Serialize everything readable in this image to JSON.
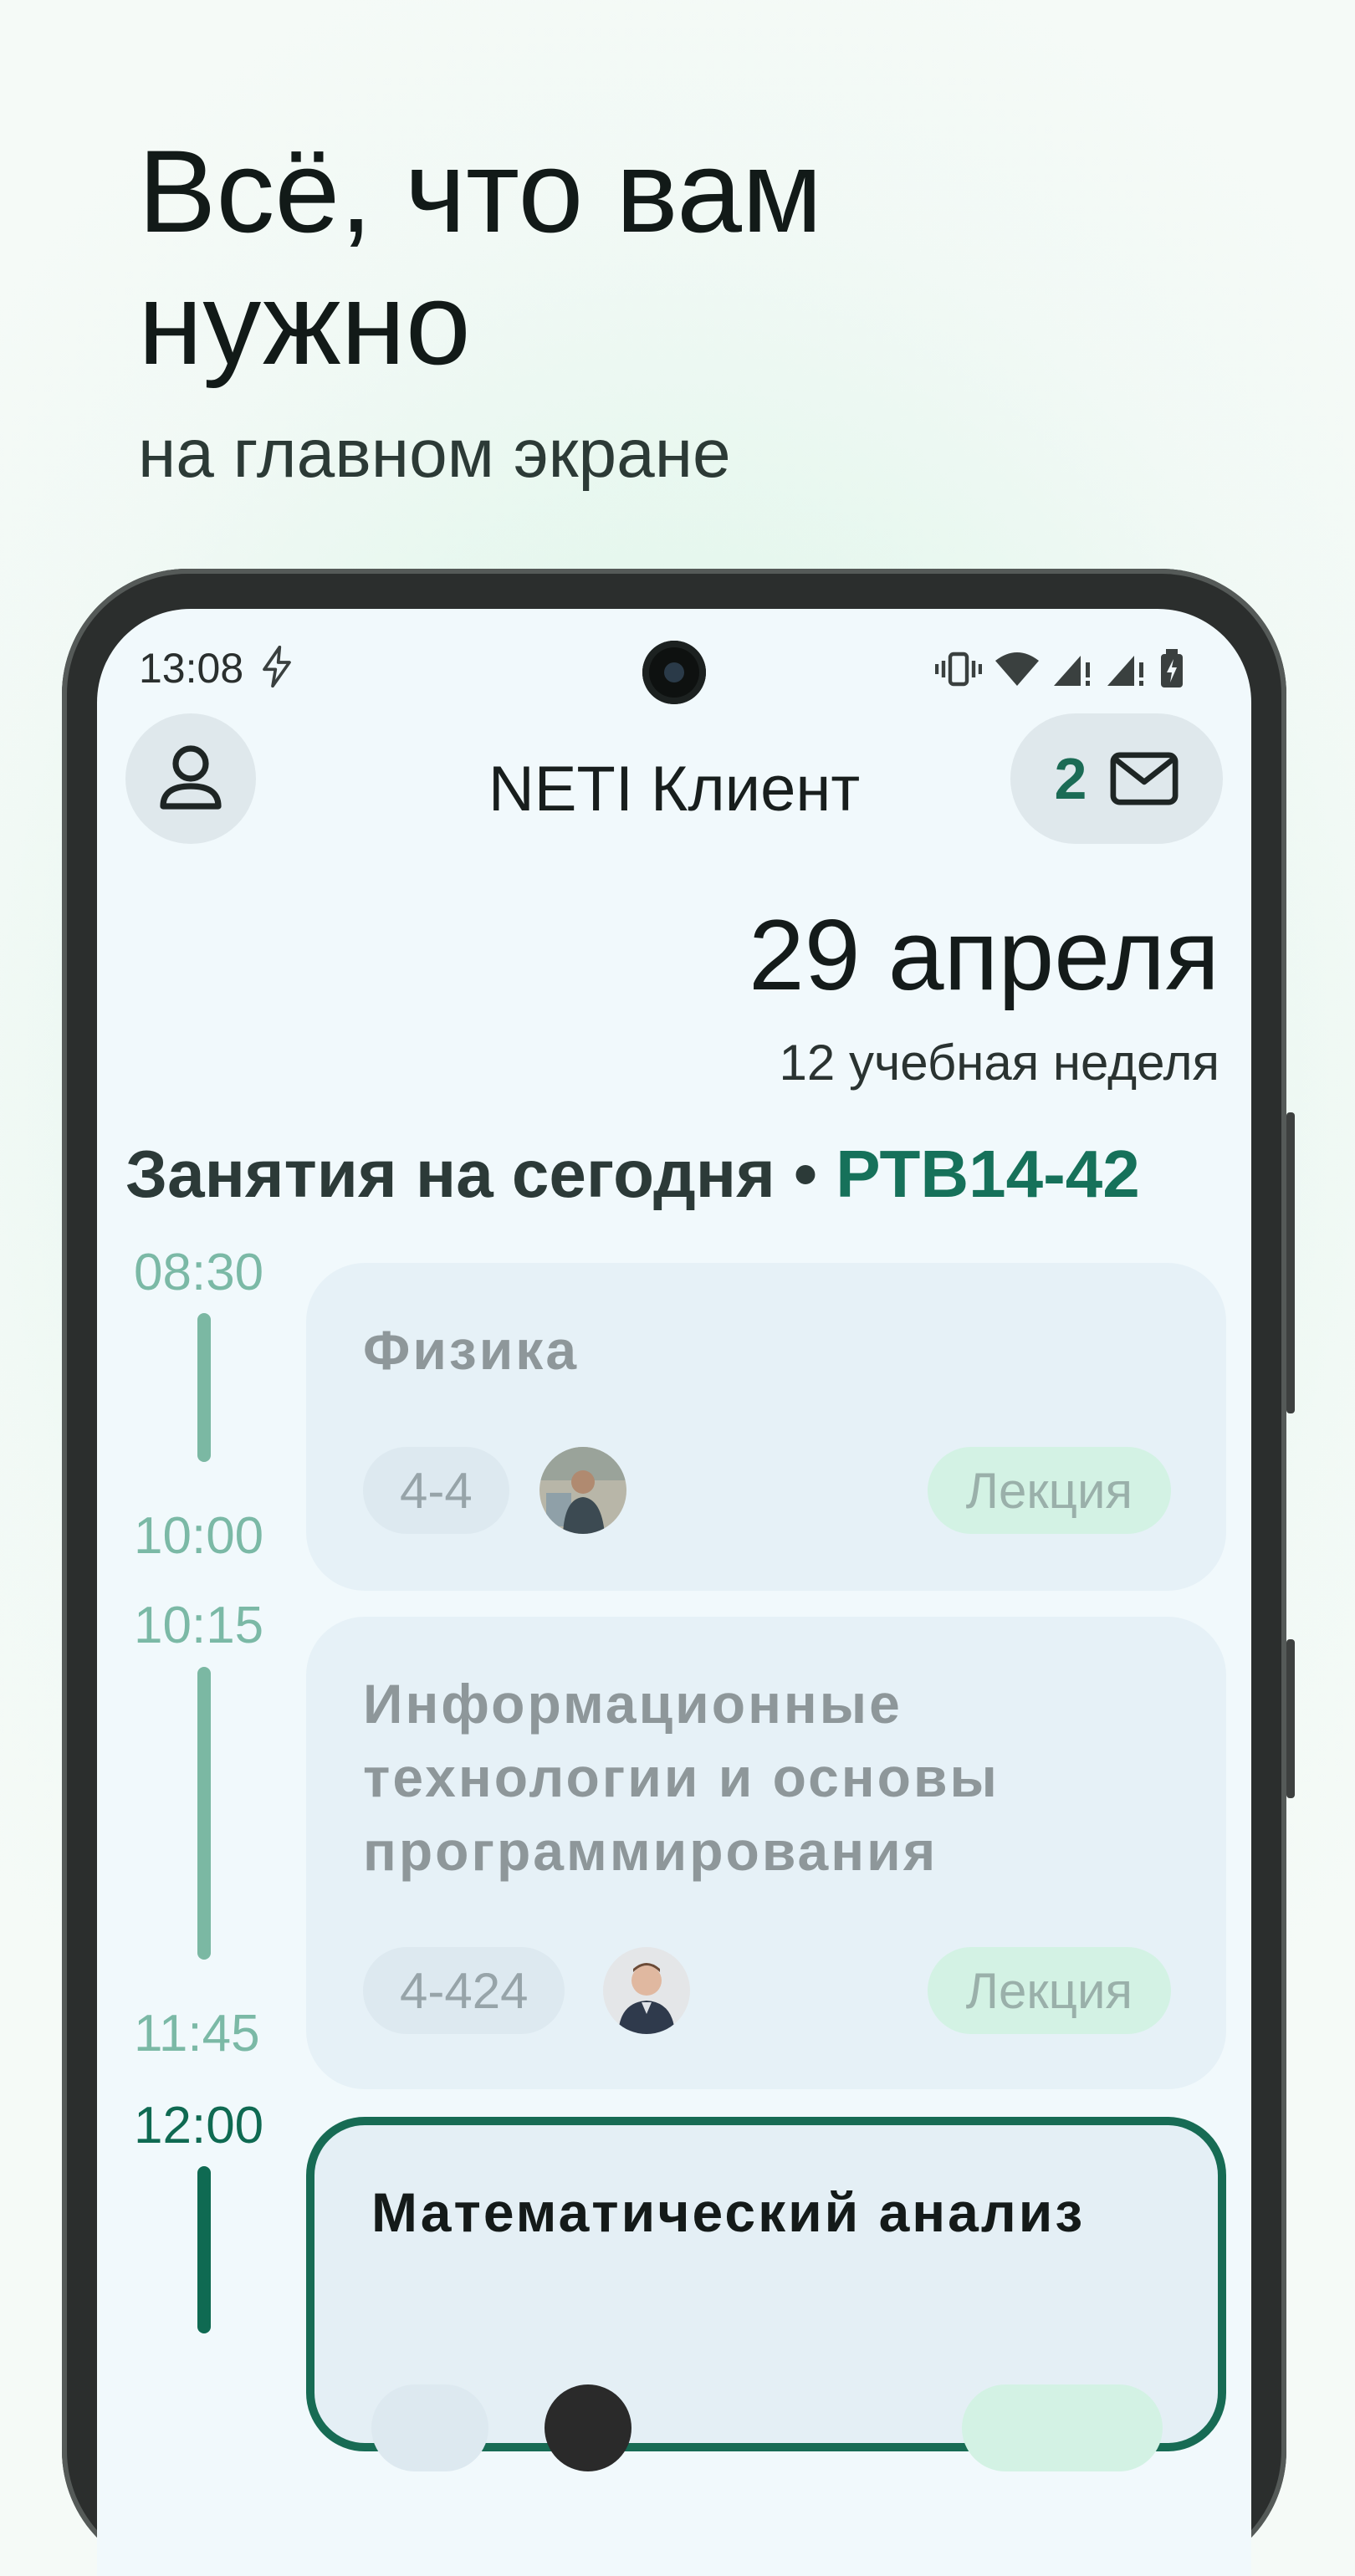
{
  "promo": {
    "title": "Всё, что вам нужно",
    "subtitle": "на главном экране"
  },
  "status_bar": {
    "time": "13:08",
    "icons": [
      "charging-bolt-icon",
      "vibrate-icon",
      "wifi-icon",
      "signal-icon",
      "signal-icon",
      "battery-icon"
    ]
  },
  "app": {
    "title": "NETI Клиент",
    "unread_count": "2",
    "profile_icon": "person-icon",
    "mail_icon": "envelope-icon"
  },
  "date": {
    "day": "29 апреля",
    "week": "12 учебная неделя"
  },
  "schedule": {
    "heading": "Занятия на сегодня •",
    "group": "РТВ14-42",
    "lessons": [
      {
        "start": "08:30",
        "end": "10:00",
        "title": "Физика",
        "room": "4-4",
        "type": "Лекция",
        "current": false
      },
      {
        "start": "10:15",
        "end": "11:45",
        "title": "Информационные технологии и основы программирования",
        "room": "4-424",
        "type": "Лекция",
        "current": false
      },
      {
        "start": "12:00",
        "end": "",
        "title": "Математический анализ",
        "room": "",
        "type": "",
        "current": true
      }
    ]
  },
  "colors": {
    "accent": "#176b54",
    "muted_time": "#7bb9a6",
    "card_bg": "#e6f1f7",
    "type_chip": "#d3f2e4"
  }
}
